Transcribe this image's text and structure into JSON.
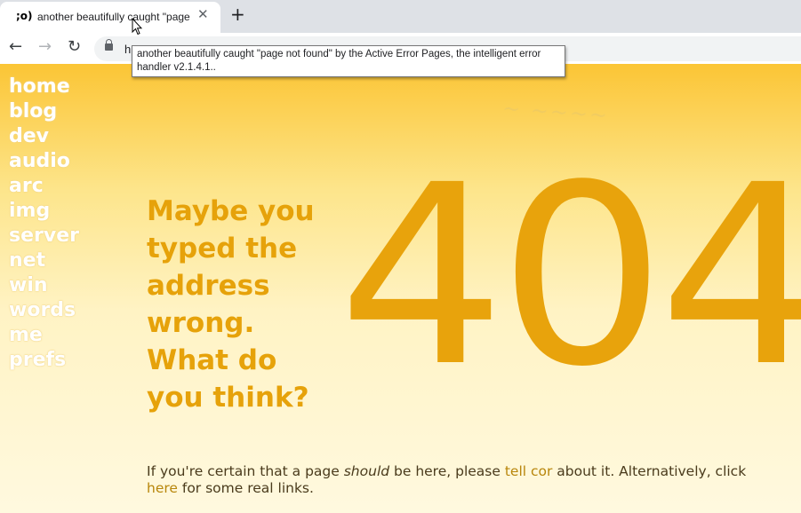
{
  "browser": {
    "tab": {
      "favicon": ";o)",
      "title": "another beautifully caught \"page not found\"",
      "close_glyph": "✕"
    },
    "new_tab_glyph": "+",
    "nav": {
      "back_glyph": "←",
      "forward_glyph": "→",
      "reload_glyph": "↻"
    },
    "url_fragment": "h",
    "tooltip": "another beautifully caught \"page not found\" by the Active Error Pages, the intelligent error handler v2.1.4.1.."
  },
  "sidebar": {
    "items": [
      {
        "label": "home"
      },
      {
        "label": "blog"
      },
      {
        "label": "dev"
      },
      {
        "label": "audio"
      },
      {
        "label": "arc"
      },
      {
        "label": "img"
      },
      {
        "label": "server"
      },
      {
        "label": "net"
      },
      {
        "label": "win"
      },
      {
        "label": "words"
      },
      {
        "label": "me"
      },
      {
        "label": "prefs"
      }
    ]
  },
  "main": {
    "headline": "Maybe you typed the address wrong. What do you think?",
    "error_code": "404",
    "footer": {
      "part1": "If you're certain that a page ",
      "emphasis": "should",
      "part2": " be here, please ",
      "link1": "tell cor",
      "part3": " about it. Alternatively, click ",
      "link2": "here",
      "part4": " for some real links."
    }
  },
  "colors": {
    "accent": "#e8a30c",
    "background_top": "#fbc535",
    "background_bottom": "#fff9df"
  }
}
